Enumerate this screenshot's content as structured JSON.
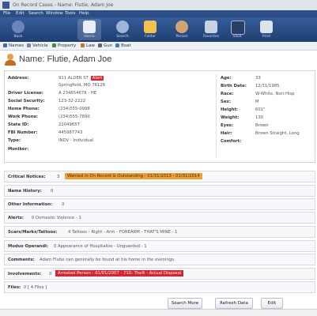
{
  "window": {
    "title": "On Record Cases - Name: Flutie, Adam Joe"
  },
  "menubar": [
    "File",
    "Edit",
    "Search",
    "Window",
    "Tools",
    "Help"
  ],
  "toolbar": {
    "buttons": [
      {
        "label": "Back",
        "icon": "arrow-left-icon",
        "color": "#6a86b8"
      },
      {
        "label": "Home",
        "icon": "home-icon",
        "color": "#e9eef7"
      },
      {
        "label": "Search",
        "icon": "search-icon",
        "color": "#9fb4d6"
      },
      {
        "label": "Folder",
        "icon": "folder-icon",
        "color": "#f2c14e"
      },
      {
        "label": "Person",
        "icon": "person-icon",
        "color": "#d0a570"
      },
      {
        "label": "Favorites",
        "icon": "star-icon",
        "color": "#c8d2e3"
      },
      {
        "label": "Save",
        "icon": "save-icon",
        "color": "#2b3f66"
      },
      {
        "label": "Print",
        "icon": "print-icon",
        "color": "#dde3ec"
      }
    ]
  },
  "subbar": {
    "items": [
      {
        "label": "Names",
        "color": "#3b6fb6"
      },
      {
        "label": "Vehicle",
        "color": "#6c8bb8"
      },
      {
        "label": "Property",
        "color": "#4b8a3c"
      },
      {
        "label": "Law",
        "color": "#c0782a"
      },
      {
        "label": "Gun",
        "color": "#666666"
      },
      {
        "label": "Boat",
        "color": "#3b82b6"
      }
    ]
  },
  "header": {
    "name_label": "Name:",
    "name_value": "Flutie, Adam Joe"
  },
  "left_fields": [
    {
      "label": "Address:",
      "value": "911 ALDER ST",
      "badge": "Alert"
    },
    {
      "label": "",
      "value": "Springfield, MO 76126"
    },
    {
      "label": "Driver License:",
      "value": "A 234654678 - HE"
    },
    {
      "label": "Social Security:",
      "value": "123-32-2222"
    },
    {
      "label": "Home Phone:",
      "value": "(234)555-0998"
    },
    {
      "label": "Work Phone:",
      "value": "(234)555-7890"
    },
    {
      "label": "State ID:",
      "value": "2204965T"
    },
    {
      "label": "FBI Number:",
      "value": "445987743"
    },
    {
      "label": "Type:",
      "value": "INDV - Individual"
    },
    {
      "label": "Moniker:",
      "value": ""
    }
  ],
  "right_fields": [
    {
      "label": "Age:",
      "value": "33"
    },
    {
      "label": "Birth Date:",
      "value": "12/31/1985"
    },
    {
      "label": "Race:",
      "value": "W-White, Non-Hisp"
    },
    {
      "label": "Sex:",
      "value": "M"
    },
    {
      "label": "Height:",
      "value": "601\""
    },
    {
      "label": "Weight:",
      "value": "130"
    },
    {
      "label": "Eyes:",
      "value": "Brown"
    },
    {
      "label": "Hair:",
      "value": "Brown Straight, Long"
    },
    {
      "label": "Comfort:",
      "value": ""
    }
  ],
  "sections": {
    "critical_notices": {
      "label": "Critical Notices:",
      "count": "3",
      "alert": "Wanted in On Record & Outstanding - 01/31/2013 - 01/31/2014",
      "alert_color": "#f0a032"
    },
    "name_history": {
      "label": "Name History:",
      "count": "0"
    },
    "other_information": {
      "label": "Other Information:",
      "count": "0"
    },
    "alerts": {
      "label": "Alerts:",
      "value": "0 Domestic Violence - 1"
    },
    "scars": {
      "label": "Scars/Marks/Tattoos:",
      "value": "4 Tattoos - Right - Arm - FOREARM - THAT'S MINE - 1"
    },
    "modus": {
      "label": "Modus Operandi:",
      "value": "0 Appearance of Hospitalize - Unguarded - 1"
    },
    "comments": {
      "label": "Comments:",
      "value": "Adam Flutie can generally be found at his home in the evenings."
    },
    "involvements": {
      "label": "Involvements:",
      "count": "0",
      "alert": "Arrested Person - 01/01/2007 - 710: Theft - Actual Disposal",
      "alert_color": "#d9232e"
    },
    "files": {
      "label": "Files:",
      "value": "0  [ 4 Files ]"
    }
  },
  "buttons": {
    "search_more": "Search More",
    "refresh": "Refresh Data",
    "edit": "Edit"
  }
}
